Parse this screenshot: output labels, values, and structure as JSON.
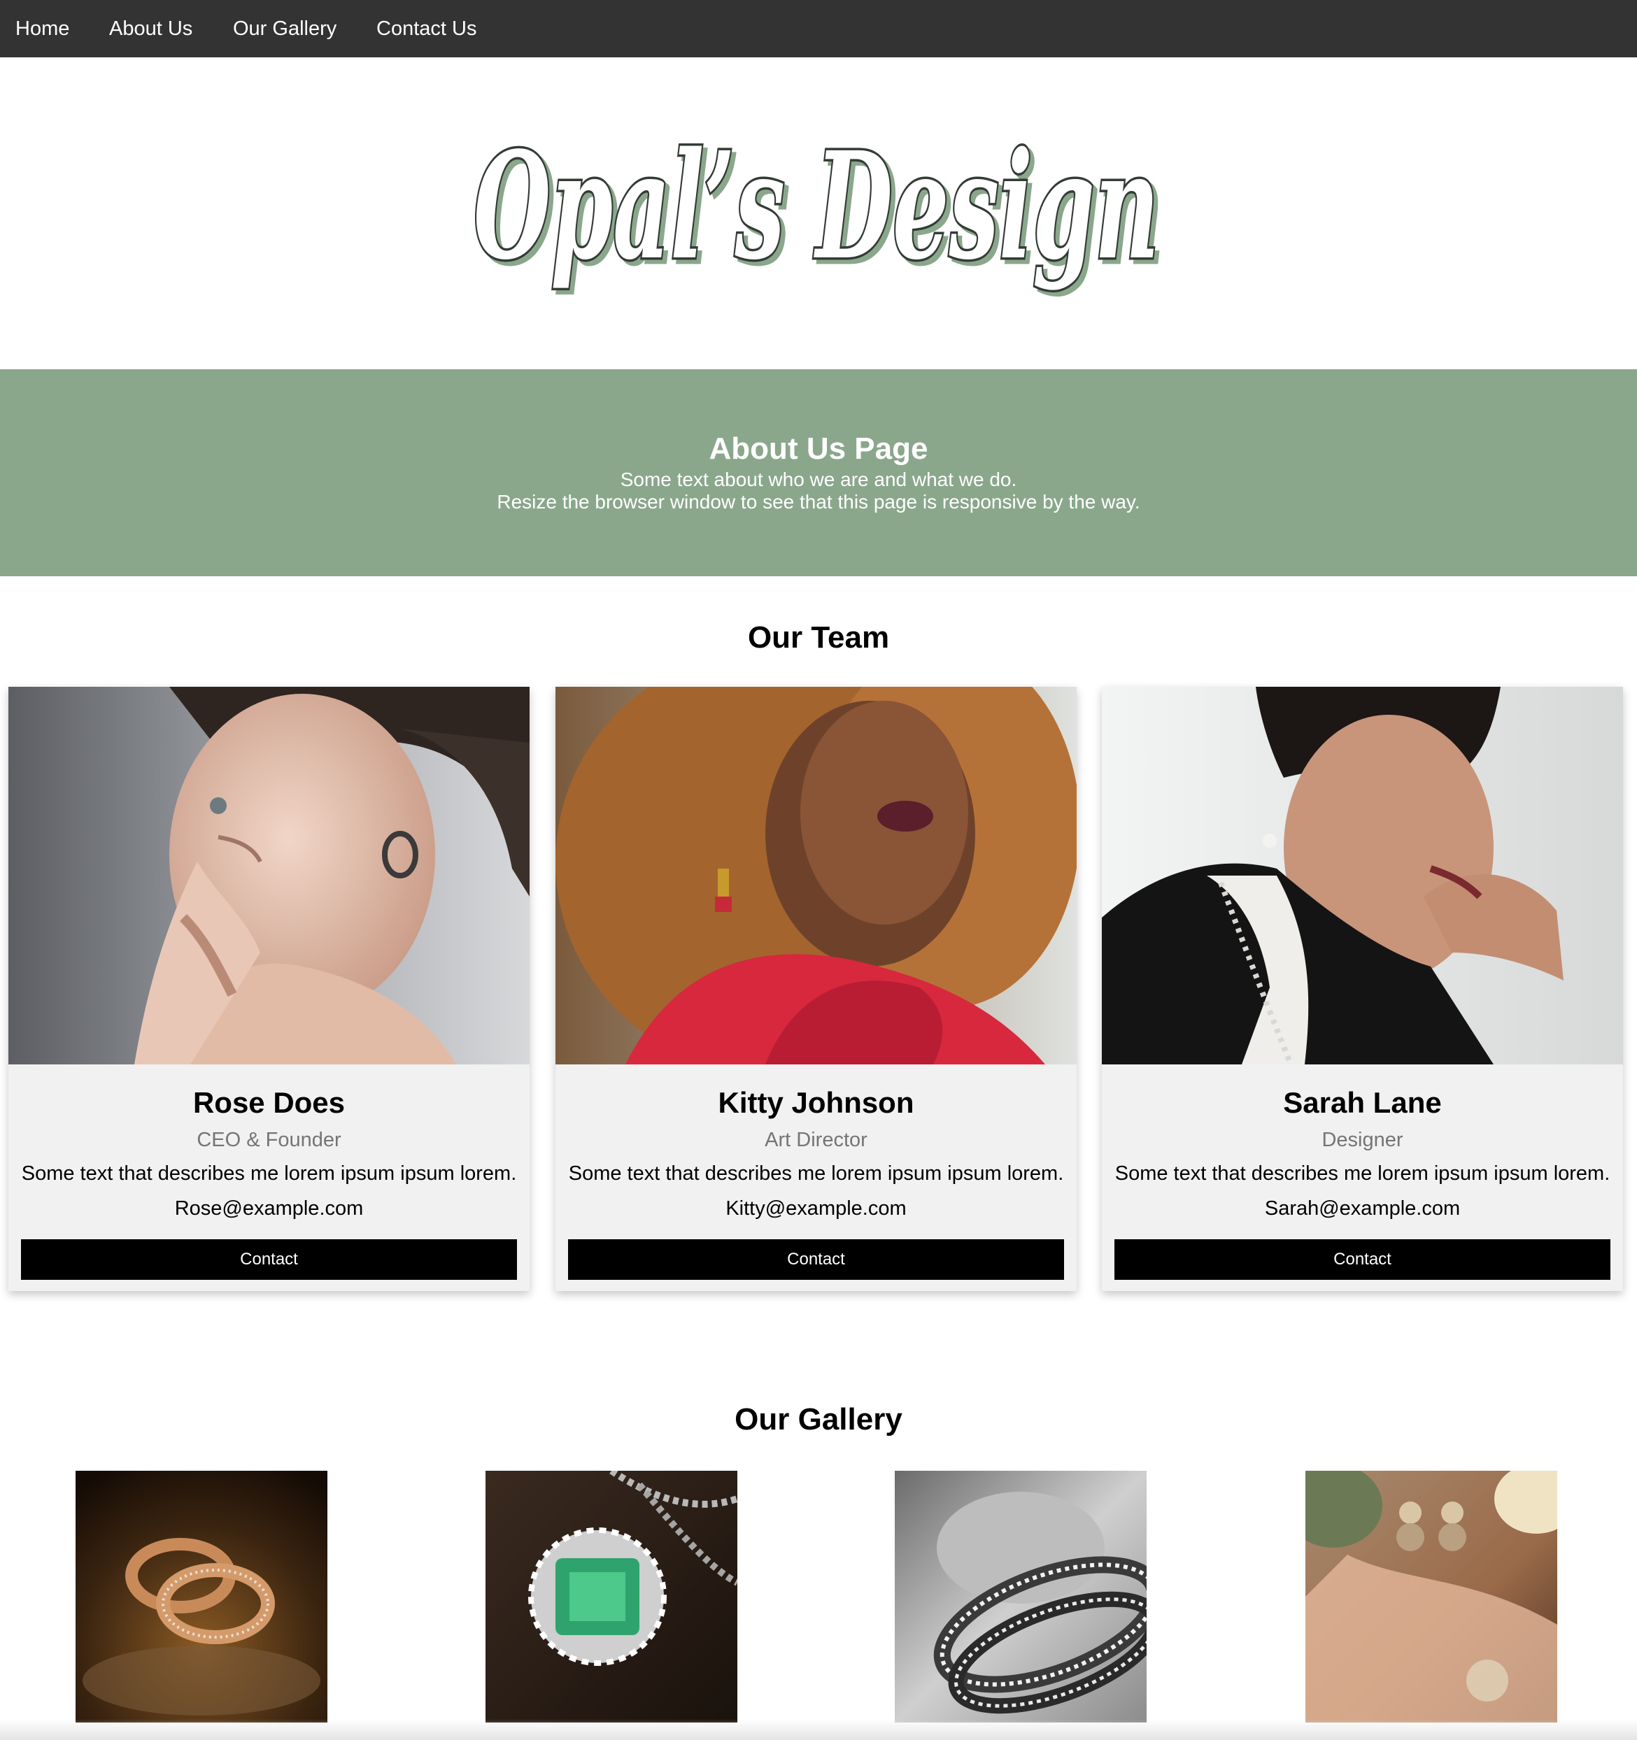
{
  "nav": {
    "items": [
      {
        "label": "Home"
      },
      {
        "label": "About Us"
      },
      {
        "label": "Our Gallery"
      },
      {
        "label": "Contact Us"
      }
    ]
  },
  "logo": {
    "text": "Opal’s Design"
  },
  "hero": {
    "title": "About Us Page",
    "line1": "Some text about who we are and what we do.",
    "line2": "Resize the browser window to see that this page is responsive by the way."
  },
  "team": {
    "heading": "Our Team",
    "members": [
      {
        "name": "Rose Does",
        "title": "CEO & Founder",
        "description": "Some text that describes me lorem ipsum ipsum lorem.",
        "email": "Rose@example.com",
        "button": "Contact"
      },
      {
        "name": "Kitty Johnson",
        "title": "Art Director",
        "description": "Some text that describes me lorem ipsum ipsum lorem.",
        "email": "Kitty@example.com",
        "button": "Contact"
      },
      {
        "name": "Sarah Lane",
        "title": "Designer",
        "description": "Some text that describes me lorem ipsum ipsum lorem.",
        "email": "Sarah@example.com",
        "button": "Contact"
      }
    ]
  },
  "gallery": {
    "heading": "Our Gallery",
    "images": [
      "rose-gold-rings",
      "emerald-pendant",
      "silver-rings",
      "gold-earrings-lace"
    ]
  },
  "colors": {
    "nav_bg": "#333333",
    "accent_green": "#8aa78c",
    "card_bg": "#f1f1f1",
    "button_bg": "#000000",
    "muted_text": "#757575"
  }
}
